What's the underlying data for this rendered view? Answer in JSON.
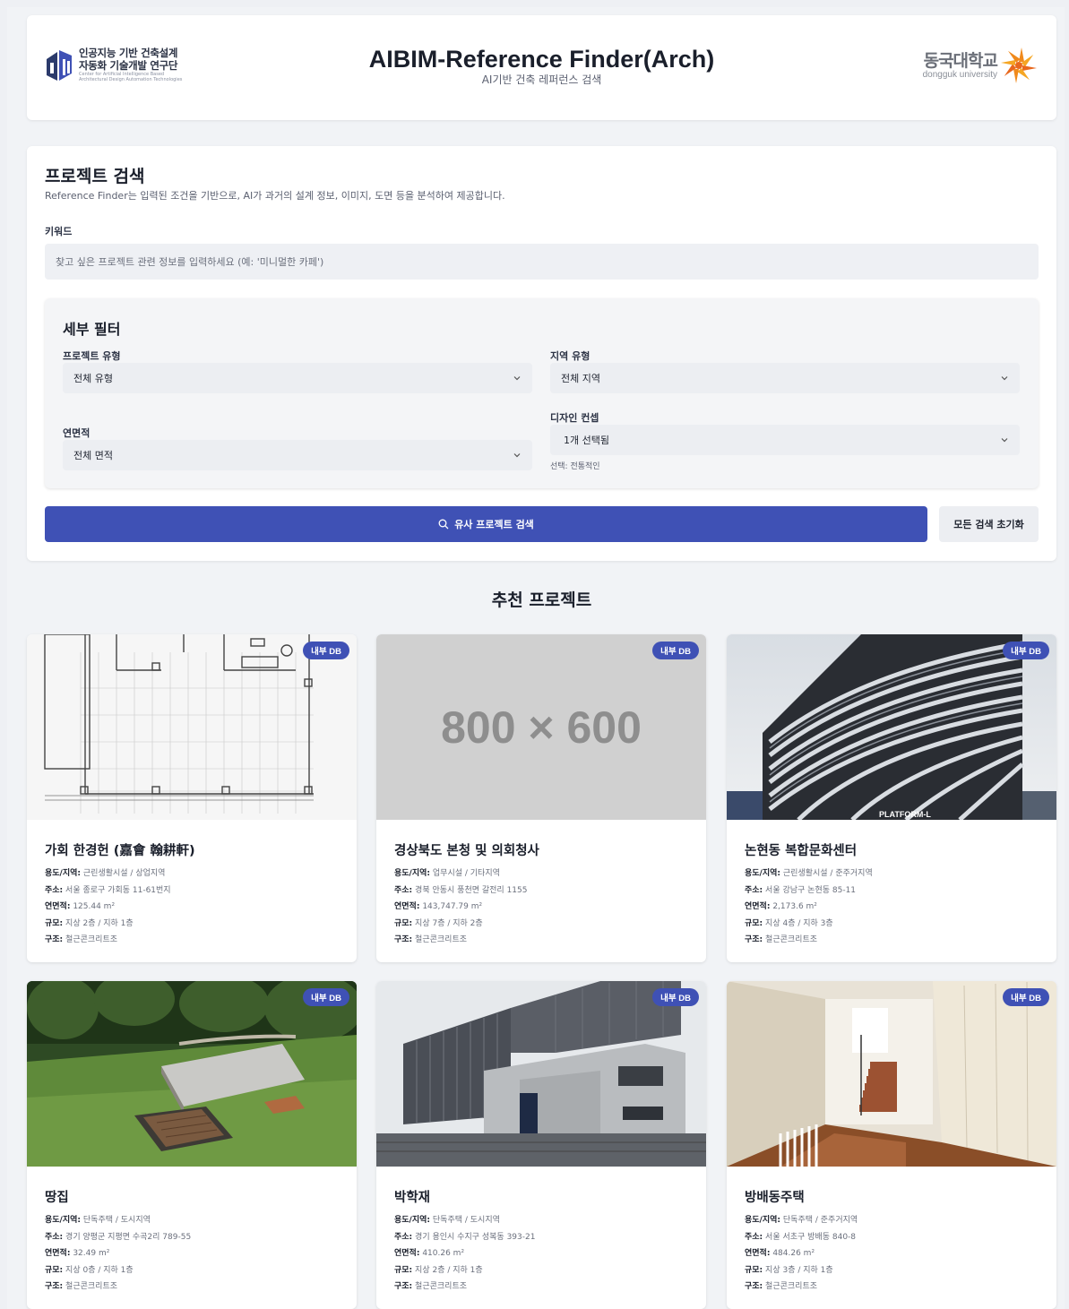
{
  "header": {
    "org_line1": "인공지능 기반 건축설계",
    "org_line2": "자동화 기술개발 연구단",
    "org_en1": "Center for Artificial Intelligence Based",
    "org_en2": "Architectural Design Automation Technologies",
    "title": "AIBIM-Reference Finder(Arch)",
    "subtitle": "AI기반 건축 레퍼런스 검색",
    "univ_ko": "동국대학교",
    "univ_en": "dongguk university"
  },
  "search": {
    "title": "프로젝트 검색",
    "description": "Reference Finder는 입력된 조건을 기반으로, AI가 과거의 설계 정보, 이미지, 도면 등을 분석하여 제공합니다.",
    "keyword_label": "키워드",
    "keyword_value": "",
    "keyword_placeholder": "찾고 싶은 프로젝트 관련 정보를 입력하세요 (예: '미니멀한 카페')",
    "filters": {
      "title": "세부 필터",
      "project_type_label": "프로젝트 유형",
      "project_type_value": "전체 유형",
      "region_type_label": "지역 유형",
      "region_type_value": "전체 지역",
      "area_label": "연면적",
      "area_value": "전체 면적",
      "concept_label": "디자인 컨셉",
      "concept_value": "1개 선택됨",
      "concept_hint": "선택: 전통적인"
    },
    "search_button": "유사 프로젝트 검색",
    "reset_button": "모든 검색 초기화"
  },
  "recommend": {
    "title": "추천 프로젝트",
    "labels": {
      "use": "용도/지역:",
      "address": "주소:",
      "area": "연면적:",
      "scale": "규모:",
      "structure": "구조:"
    },
    "cards": [
      {
        "title": "가회 한경헌 (嘉會 翰耕軒)",
        "badge": "내부 DB",
        "use": "근린생활시설 / 상업지역",
        "address": "서울 종로구 가회동 11-61번지",
        "area": "125.44 m²",
        "scale": "지상 2층 / 지하 1층",
        "structure": "철근콘크리트조"
      },
      {
        "title": "경상북도 본청 및 의회청사",
        "badge": "내부 DB",
        "placeholder": "800 × 600",
        "use": "업무시설 / 기타지역",
        "address": "경북 안동시 풍천면 갈전리 1155",
        "area": "143,747.79 m²",
        "scale": "지상 7층 / 지하 2층",
        "structure": "철근콘크리트조"
      },
      {
        "title": "논현동 복합문화센터",
        "badge": "내부 DB",
        "sign": "PLATFORM-L",
        "use": "근린생활시설 / 준주거지역",
        "address": "서울 강남구 논현동 85-11",
        "area": "2,173.6 m²",
        "scale": "지상 4층 / 지하 3층",
        "structure": "철근콘크리트조"
      },
      {
        "title": "땅집",
        "badge": "내부 DB",
        "use": "단독주택 / 도시지역",
        "address": "경기 양평군 지평면 수곡2리 789-55",
        "area": "32.49 m²",
        "scale": "지상 0층 / 지하 1층",
        "structure": "철근콘크리트조"
      },
      {
        "title": "박학재",
        "badge": "내부 DB",
        "use": "단독주택 / 도시지역",
        "address": "경기 용인시 수지구 성복동 393-21",
        "area": "410.26 m²",
        "scale": "지상 2층 / 지하 1층",
        "structure": "철근콘크리트조"
      },
      {
        "title": "방배동주택",
        "badge": "내부 DB",
        "use": "단독주택 / 준주거지역",
        "address": "서울 서초구 방배동 840-8",
        "area": "484.26 m²",
        "scale": "지상 3층 / 지하 1층",
        "structure": "철근콘크리트조"
      }
    ]
  },
  "colors": {
    "accent": "#3f51b5",
    "page_bg": "#eef0f4",
    "panel_bg": "#ffffff",
    "input_bg": "#eef0f4"
  },
  "icons": [
    "institute-logo-icon",
    "dongguk-logo-icon",
    "search-icon",
    "chevron-down-icon"
  ]
}
